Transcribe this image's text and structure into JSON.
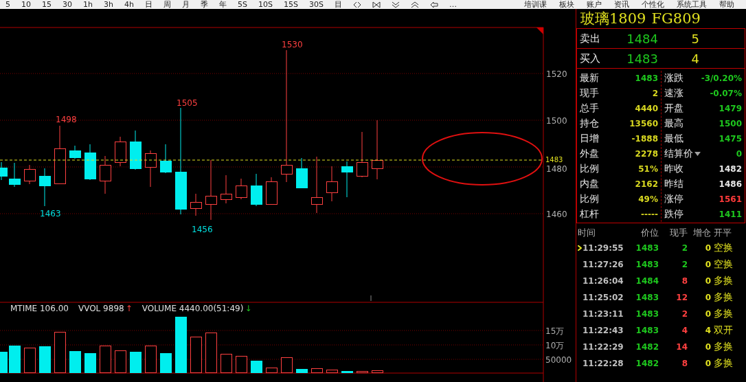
{
  "toolbar": {
    "periods": [
      "5",
      "10",
      "15",
      "30",
      "1h",
      "3h",
      "4h",
      "日",
      "周",
      "月",
      "季",
      "年",
      "5S",
      "10S",
      "15S",
      "30S",
      "目"
    ],
    "more": "…",
    "menus": [
      "培训课",
      "板块",
      "账户",
      "资讯",
      "个性化",
      "系统工具",
      "帮助"
    ]
  },
  "chart": {
    "price_ticks": [
      "1520",
      "1500",
      "1480",
      "1460"
    ],
    "last_price": "1483",
    "extreme_labels": [
      {
        "text": "1530",
        "kind": "high"
      },
      {
        "text": "1505",
        "kind": "high"
      },
      {
        "text": "1498",
        "kind": "high"
      },
      {
        "text": "1463",
        "kind": "low"
      },
      {
        "text": "1456",
        "kind": "low"
      }
    ]
  },
  "volume": {
    "legend": [
      {
        "text": "MTIME 106.00"
      },
      {
        "text": "VVOL 9898",
        "arrow": "↑",
        "kind": "up"
      },
      {
        "text": "VOLUME 4440.00(51:49)",
        "arrow": "↓",
        "kind": "down"
      }
    ],
    "ticks": [
      "15万",
      "10万",
      "50000"
    ]
  },
  "panel": {
    "name": "玻璃1809",
    "code": "FG809",
    "book": [
      {
        "label": "卖出",
        "price": "1484",
        "volume": "5"
      },
      {
        "label": "买入",
        "price": "1483",
        "volume": "4"
      }
    ],
    "stats": [
      {
        "left": {
          "label": "最新",
          "value": "1483",
          "color": "#1ec81e"
        },
        "right": {
          "label": "涨跌",
          "value": "-3/0.20%",
          "color": "#1ec81e"
        }
      },
      {
        "left": {
          "label": "现手",
          "value": "2",
          "color": "#d8d820"
        },
        "right": {
          "label": "速涨",
          "value": "-0.07%",
          "color": "#1ec81e"
        }
      },
      {
        "left": {
          "label": "总手",
          "value": "4440",
          "color": "#d8d820"
        },
        "right": {
          "label": "开盘",
          "value": "1479",
          "color": "#1ec81e"
        }
      },
      {
        "left": {
          "label": "持仓",
          "value": "13560",
          "color": "#d8d820"
        },
        "right": {
          "label": "最高",
          "value": "1500",
          "color": "#1ec81e"
        }
      },
      {
        "left": {
          "label": "日增",
          "value": "-1888",
          "color": "#d8d820"
        },
        "right": {
          "label": "最低",
          "value": "1475",
          "color": "#1ec81e"
        }
      },
      {
        "left": {
          "label": "外盘",
          "value": "2278",
          "color": "#d8d820"
        },
        "right": {
          "label": "结算价",
          "value": "0",
          "color": "#1ec81e",
          "dropdown": true
        }
      },
      {
        "left": {
          "label": "比例",
          "value": "51%",
          "color": "#d8d820"
        },
        "right": {
          "label": "昨收",
          "value": "1482",
          "color": "#e8e8e8"
        }
      },
      {
        "left": {
          "label": "内盘",
          "value": "2162",
          "color": "#d8d820"
        },
        "right": {
          "label": "昨结",
          "value": "1486",
          "color": "#e8e8e8"
        }
      },
      {
        "left": {
          "label": "比例",
          "value": "49%",
          "color": "#d8d820"
        },
        "right": {
          "label": "涨停",
          "value": "1561",
          "color": "#ff3a3a"
        }
      },
      {
        "left": {
          "label": "杠杆",
          "value": "-----",
          "color": "#d8d820"
        },
        "right": {
          "label": "跌停",
          "value": "1411",
          "color": "#1ec81e"
        }
      }
    ],
    "trades": {
      "columns": [
        "时间",
        "价位",
        "现手",
        "增仓",
        "开平"
      ],
      "rows": [
        {
          "time": "11:29:55",
          "price": "1483",
          "hand": "2",
          "oi": "0",
          "type": "空换",
          "color": "#1ec81e",
          "selected": true
        },
        {
          "time": "11:27:26",
          "price": "1483",
          "hand": "2",
          "oi": "0",
          "type": "空换",
          "color": "#1ec81e",
          "selected": false
        },
        {
          "time": "11:26:04",
          "price": "1484",
          "hand": "8",
          "oi": "0",
          "type": "多换",
          "color": "#ff4040",
          "selected": false
        },
        {
          "time": "11:25:02",
          "price": "1483",
          "hand": "12",
          "oi": "0",
          "type": "多换",
          "color": "#ff4040",
          "selected": false
        },
        {
          "time": "11:23:11",
          "price": "1483",
          "hand": "2",
          "oi": "0",
          "type": "多换",
          "color": "#ff4040",
          "selected": false
        },
        {
          "time": "11:22:43",
          "price": "1483",
          "hand": "4",
          "oi": "4",
          "type": "双开",
          "color": "#ff4040",
          "selected": false
        },
        {
          "time": "11:22:29",
          "price": "1482",
          "hand": "14",
          "oi": "0",
          "type": "多换",
          "color": "#ff4040",
          "selected": false
        },
        {
          "time": "11:22:28",
          "price": "1482",
          "hand": "8",
          "oi": "0",
          "type": "多换",
          "color": "#ff4040",
          "selected": false
        }
      ]
    }
  }
}
